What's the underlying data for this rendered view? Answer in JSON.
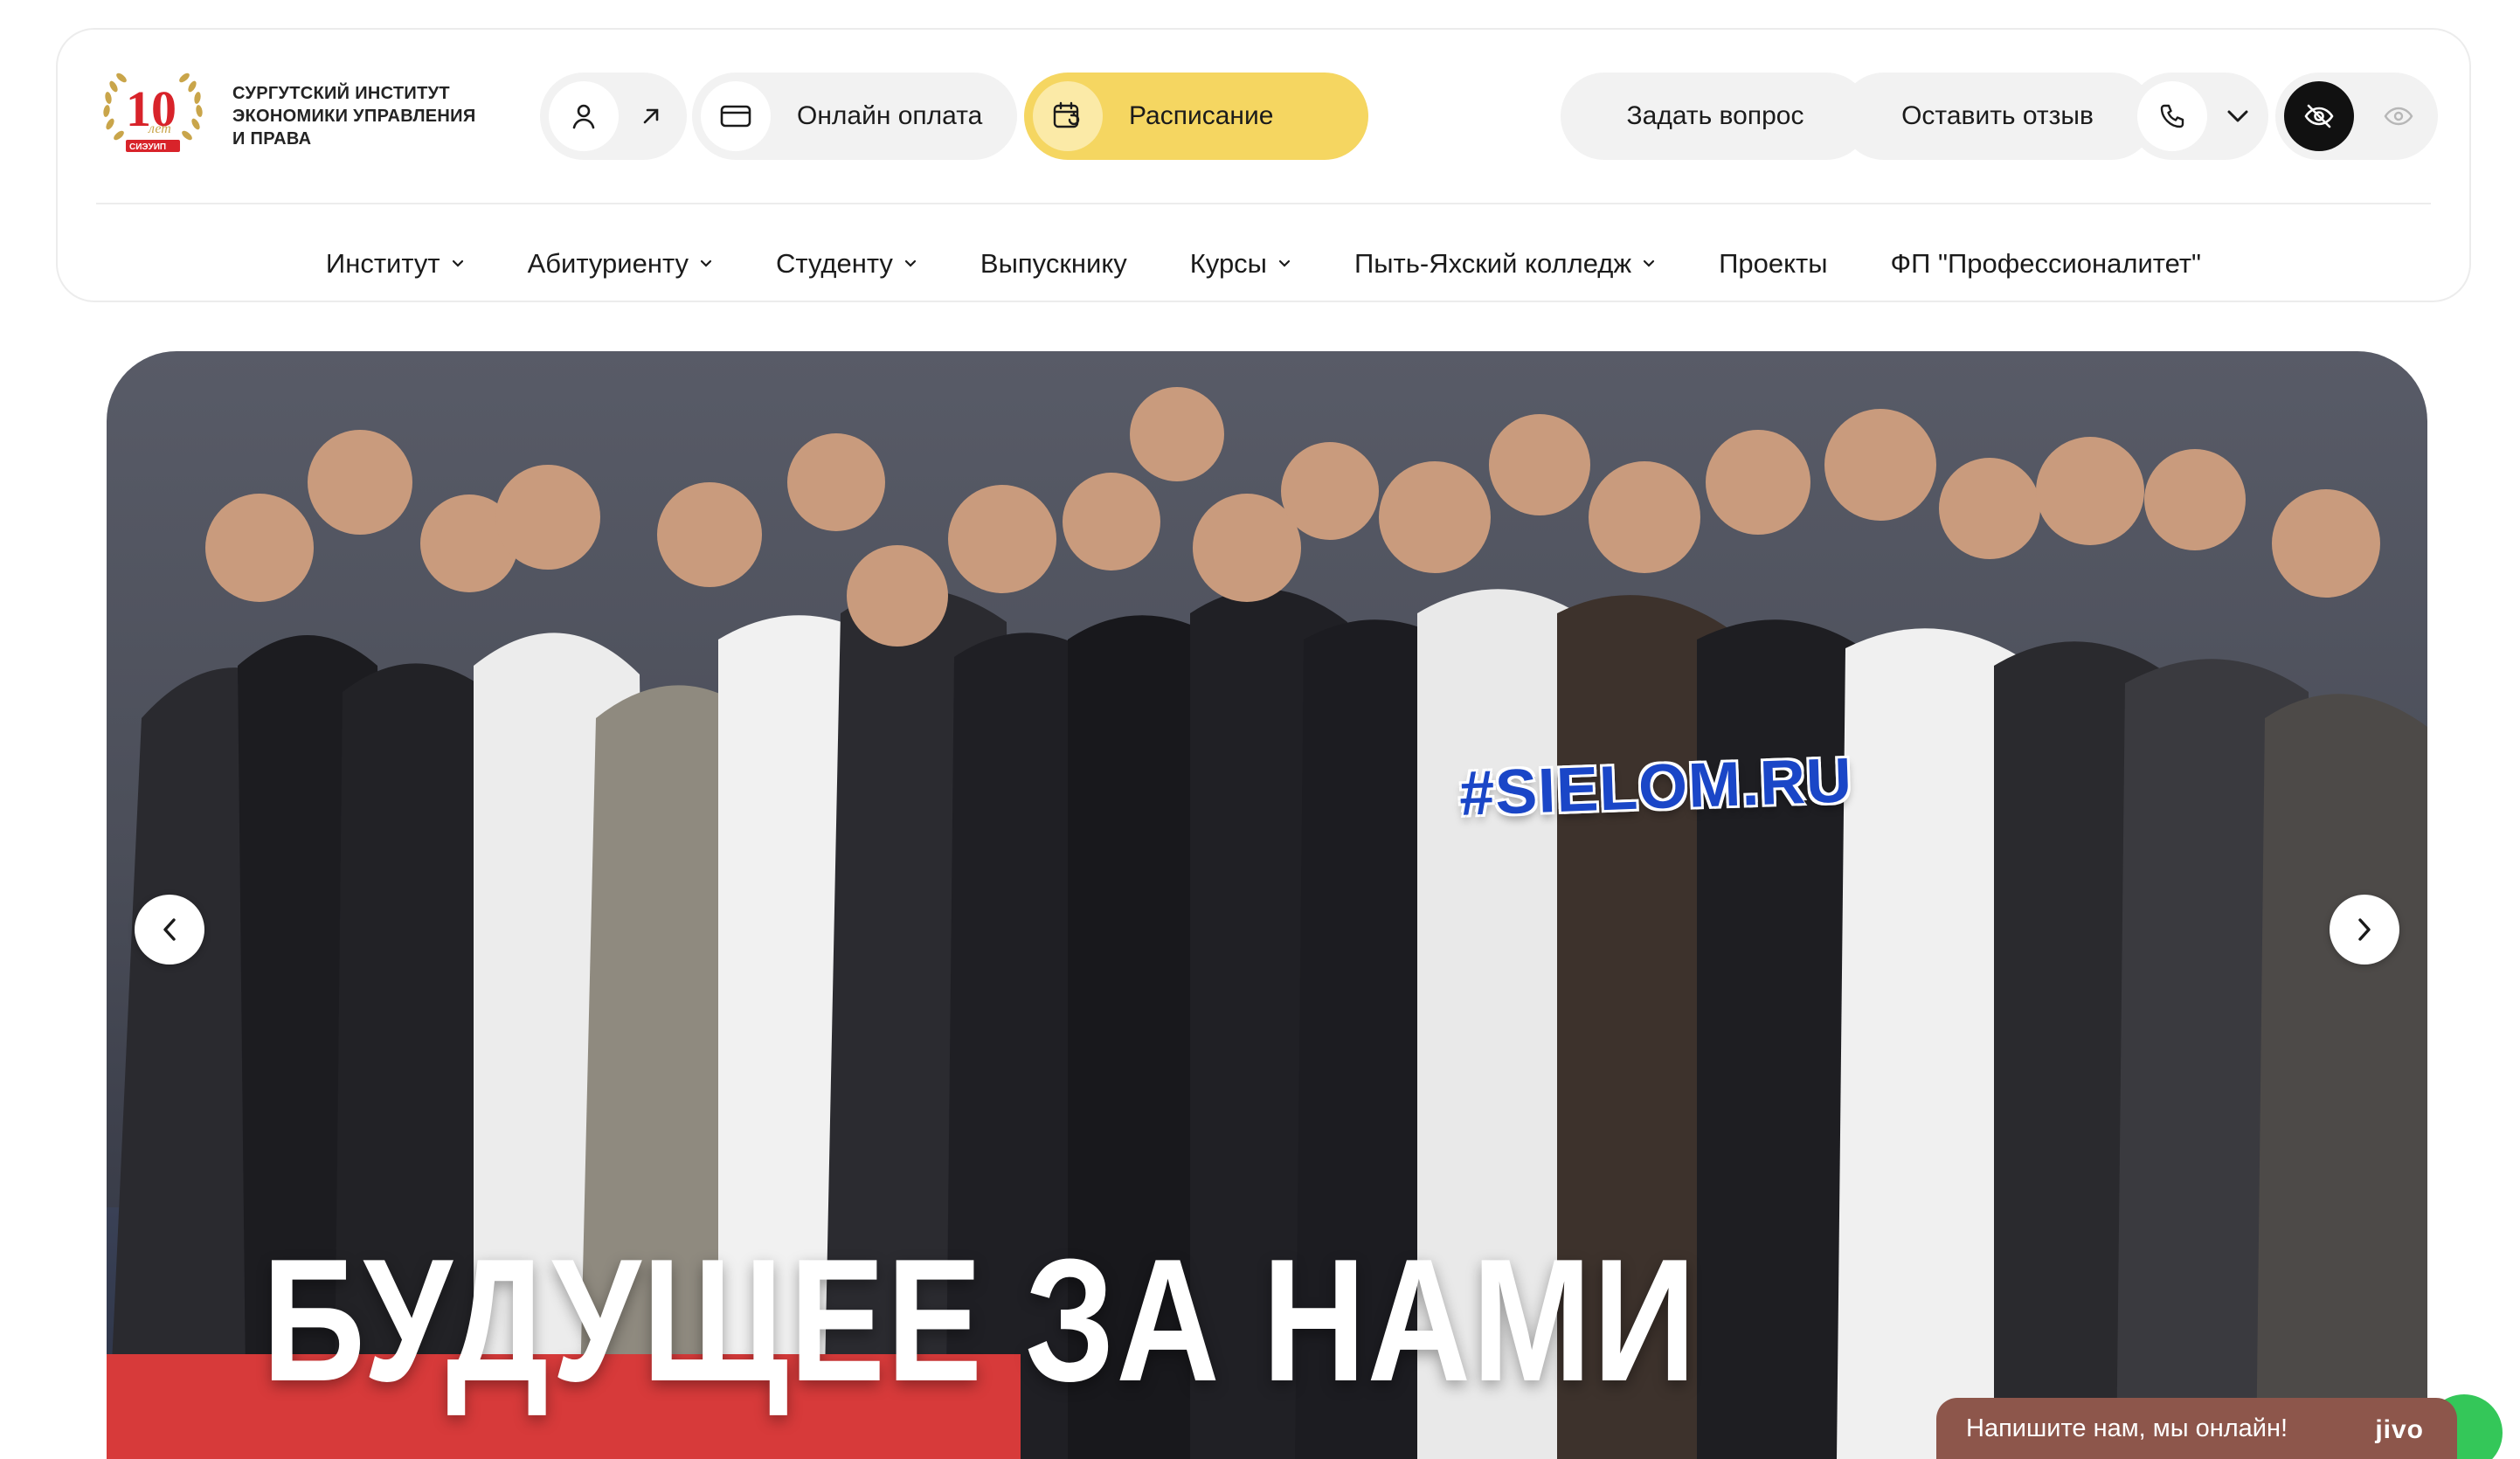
{
  "brand": {
    "logo_number": "10",
    "logo_small": "лет",
    "logo_abbr": "СИЭУИП",
    "name_line1": "СУРГУТСКИЙ ИНСТИТУТ",
    "name_line2": "ЭКОНОМИКИ УПРАВЛЕНИЯ",
    "name_line3": "И ПРАВА"
  },
  "topbar": {
    "account_icon": "user-icon",
    "online_payment": "Онлайн оплата",
    "schedule": "Расписание",
    "ask_question": "Задать вопрос",
    "leave_review": "Оставить отзыв"
  },
  "nav": {
    "items": [
      {
        "label": "Институт",
        "dropdown": true
      },
      {
        "label": "Абитуриенту",
        "dropdown": true
      },
      {
        "label": "Студенту",
        "dropdown": true
      },
      {
        "label": "Выпускнику",
        "dropdown": false
      },
      {
        "label": "Курсы",
        "dropdown": true
      },
      {
        "label": "Пыть-Яхский колледж",
        "dropdown": true
      },
      {
        "label": "Проекты",
        "dropdown": false
      },
      {
        "label": "ФП \"Профессионалитет\"",
        "dropdown": false
      }
    ]
  },
  "hero": {
    "title": "БУДУЩЕЕ ЗА НАМИ",
    "hashtag": "#SIELOM.RU"
  },
  "chat": {
    "message": "Напишите нам, мы онлайн!",
    "brand": "jivo"
  },
  "colors": {
    "accent_yellow": "#f5d661",
    "hero_red": "#d73a3a",
    "chat_brown": "#8d564b",
    "logo_red": "#d8232a",
    "logo_gold": "#c9a54a"
  }
}
